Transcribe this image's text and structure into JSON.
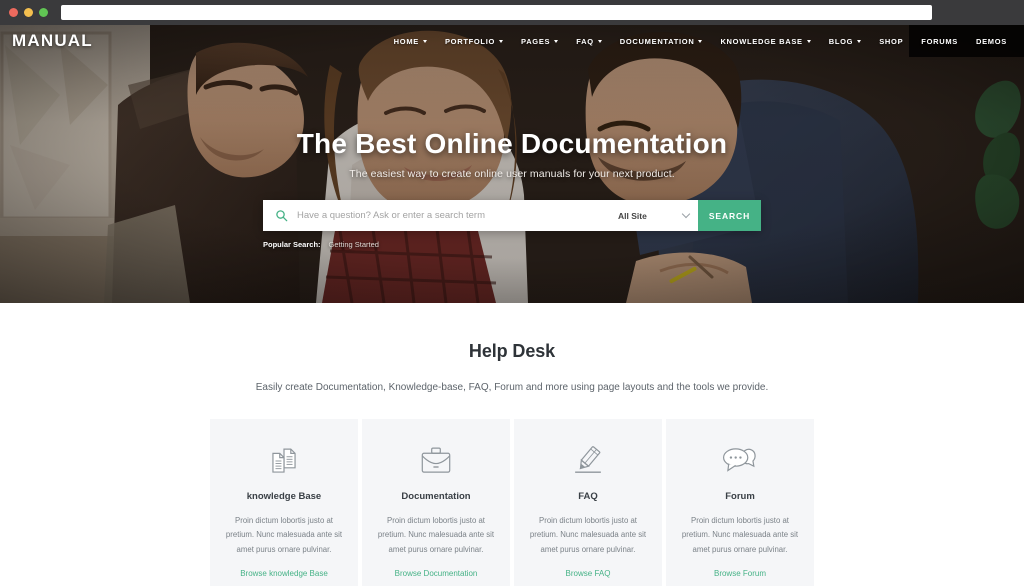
{
  "browser": {
    "traffic_lights": [
      "close",
      "minimize",
      "maximize"
    ],
    "url_value": "",
    "url_placeholder": ""
  },
  "site": {
    "logo": "MANUAL",
    "nav": [
      {
        "label": "HOME",
        "has_dropdown": true
      },
      {
        "label": "PORTFOLIO",
        "has_dropdown": true
      },
      {
        "label": "PAGES",
        "has_dropdown": true
      },
      {
        "label": "FAQ",
        "has_dropdown": true
      },
      {
        "label": "DOCUMENTATION",
        "has_dropdown": true
      },
      {
        "label": "KNOWLEDGE BASE",
        "has_dropdown": true
      },
      {
        "label": "BLOG",
        "has_dropdown": true
      },
      {
        "label": "SHOP",
        "has_dropdown": false
      },
      {
        "label": "FORUMS",
        "has_dropdown": false
      },
      {
        "label": "DEMOS",
        "has_dropdown": false
      }
    ]
  },
  "hero": {
    "title": "The Best Online Documentation",
    "subtitle": "The easiest way to create online user manuals for your next product.",
    "search": {
      "placeholder": "Have a question? Ask or enter a search term",
      "value": "",
      "scope_selected": "All Site",
      "button_label": "SEARCH",
      "icon": "search-icon"
    },
    "popular": {
      "label": "Popular Search:",
      "terms": [
        "Getting Started"
      ]
    }
  },
  "helpdesk": {
    "title": "Help Desk",
    "description": "Easily create Documentation, Knowledge-base, FAQ, Forum and more using page layouts and the tools we provide.",
    "cards": [
      {
        "icon": "documents-icon",
        "title": "knowledge Base",
        "text": "Proin dictum lobortis justo at pretium. Nunc malesuada ante sit amet purus ornare pulvinar.",
        "link": "Browse knowledge Base"
      },
      {
        "icon": "briefcase-icon",
        "title": "Documentation",
        "text": "Proin dictum lobortis justo at pretium. Nunc malesuada ante sit amet purus ornare pulvinar.",
        "link": "Browse Documentation"
      },
      {
        "icon": "pencil-icon",
        "title": "FAQ",
        "text": "Proin dictum lobortis justo at pretium. Nunc malesuada ante sit amet purus ornare pulvinar.",
        "link": "Browse FAQ"
      },
      {
        "icon": "chat-bubbles-icon",
        "title": "Forum",
        "text": "Proin dictum lobortis justo at pretium. Nunc malesuada ante sit amet purus ornare pulvinar.",
        "link": "Browse Forum"
      }
    ]
  },
  "colors": {
    "accent": "#45b286",
    "card_bg": "#f5f6f8",
    "chrome": "#3a3a3c",
    "heading": "#2e3338"
  }
}
